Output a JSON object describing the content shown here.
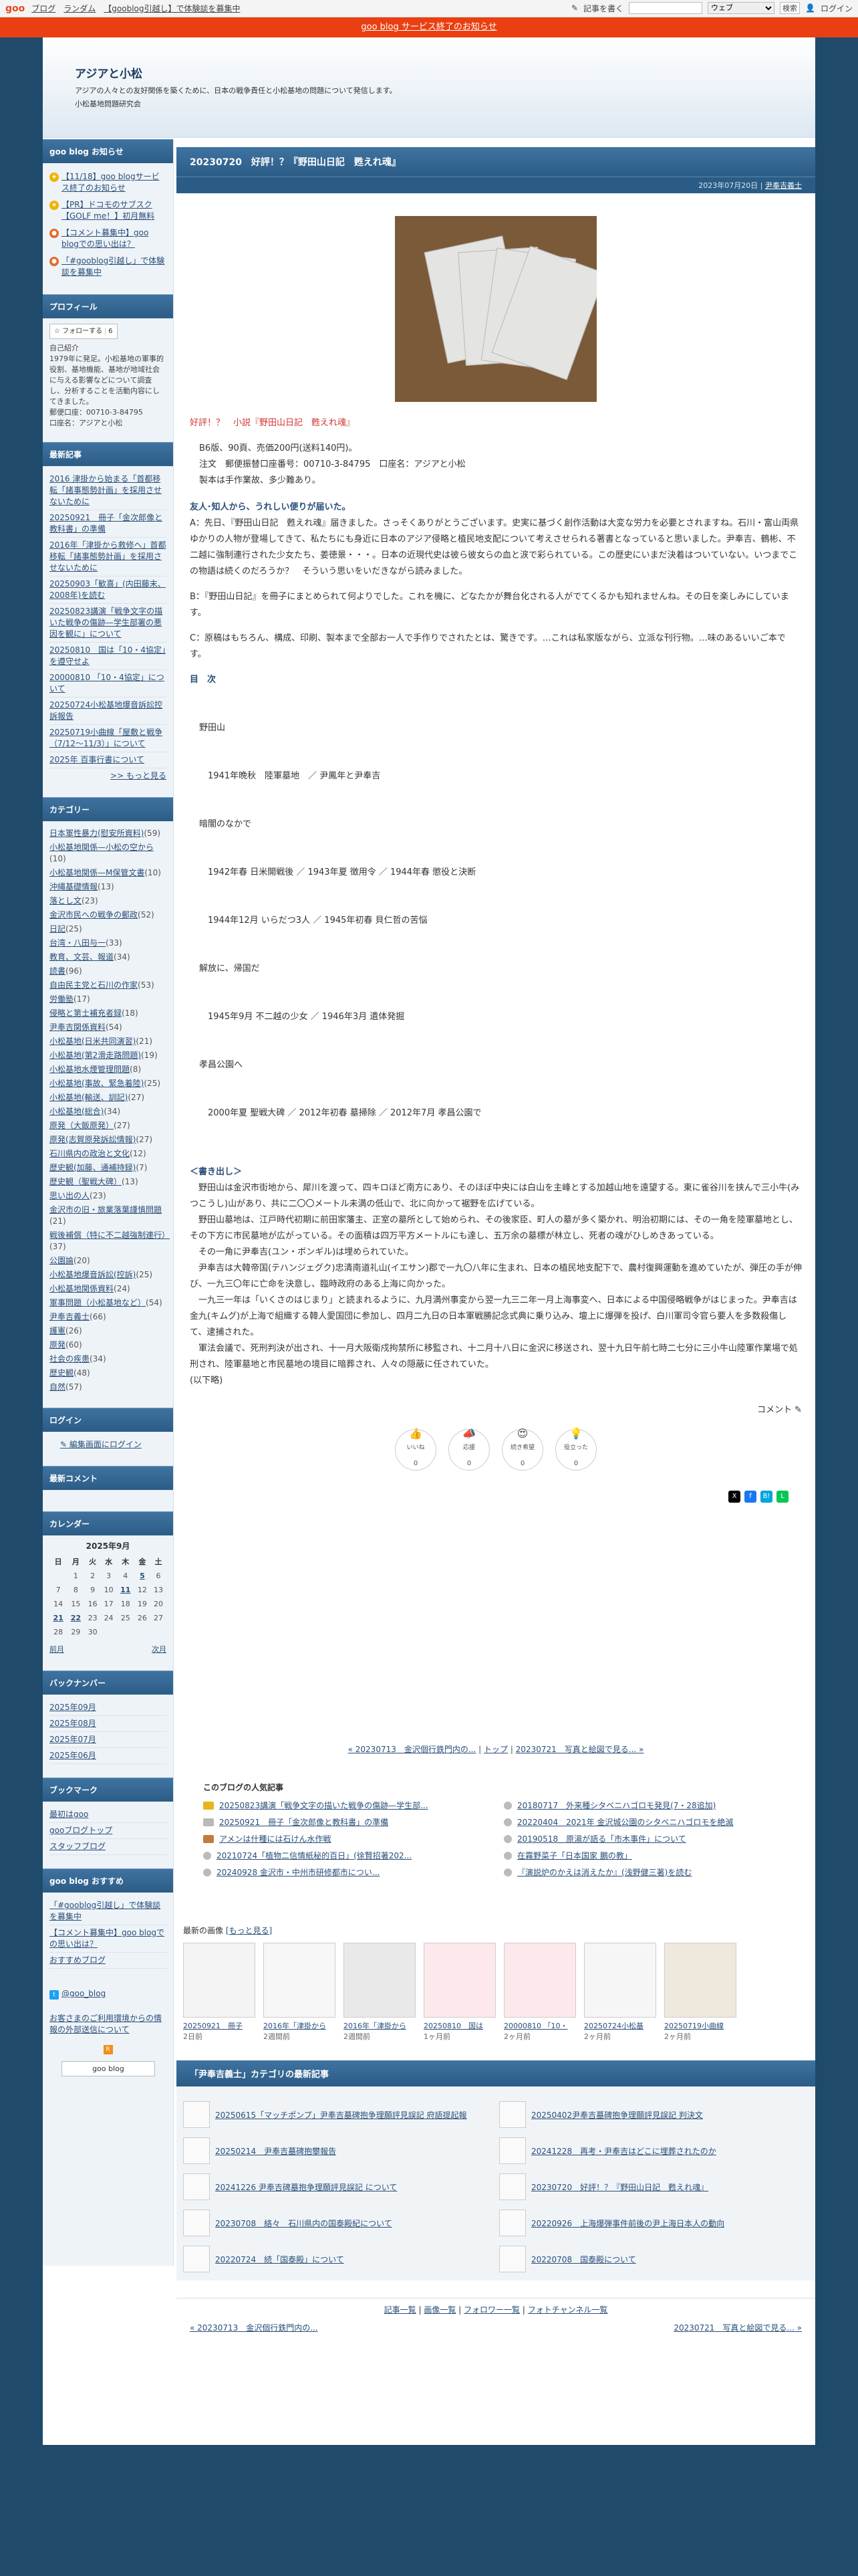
{
  "topbar": {
    "logo": "goo",
    "links": [
      "ブログ",
      "ランダム",
      "【gooblog引越し】で体験談を募集中"
    ],
    "post": "記事を書く",
    "login": "ログイン",
    "search_scope": "ウェブ",
    "search_button": "検索"
  },
  "notice": "goo blog サービス終了のお知らせ",
  "blog": {
    "title": "アジアと小松",
    "description": "アジアの人々との友好関係を築くために、日本の戦争責任と小松基地の問題について発信します。",
    "author": "小松基地問題研究会"
  },
  "sidebar": {
    "news_head": "goo blog お知らせ",
    "news": [
      "【11/18】goo blogサービス終了のお知らせ",
      "【PR】ドコモのサブスク【GOLF me！】初月無料",
      "【コメント募集中】goo blogでの思い出は？",
      "「#gooblog引越し」で体験談を募集中"
    ],
    "profile_head": "プロフィール",
    "follow_label": "フォローする",
    "follow_count": "6",
    "profile_label": "自己紹介",
    "profile_text": "1979年に発足。小松基地の軍事的役割、基地機能、基地が地域社会に与える影響などについて調査し、分析することを活動内容にしてきました。",
    "postal": "郵便口座：00710-3-84795",
    "postal_name": "口座名：アジアと小松",
    "recent_head": "最新記事",
    "recent": [
      "2016 津掛から始まる「首都移転「諸事態勢計画」を採用させないために",
      "20250921　冊子「金次郎像と教科書」の準備",
      "2016年「津掛から救修へ」首都移転「諸事態勢計画」を採用させないために",
      "20250903「歓喜」(内田藤末、2008年)を読む",
      "20250823講演「戦争文字の描いた戦争の傷跡—学生部署の悪因を観に」について",
      "20250810　国は「10・4協定」を遵守せよ",
      "20000810 「10・4協定」について",
      "20250724小松基地爆音訴訟控訴報告",
      "20250719小曲線「屋敷と戦争（7/12〜11/3）」について",
      "2025年 百事行書について"
    ],
    "recent_more": ">> もっと見る",
    "category_head": "カテゴリー",
    "categories": [
      {
        "name": "日本軍性暴力(慰安所資料)",
        "count": "(59)"
      },
      {
        "name": "小松基地関係—小松の空から",
        "count": "(10)"
      },
      {
        "name": "小松基地関係—M保管文書",
        "count": "(10)"
      },
      {
        "name": "沖縄基礎情報",
        "count": "(13)"
      },
      {
        "name": "落とし文",
        "count": "(23)"
      },
      {
        "name": "金沢市民への戦争の郵政",
        "count": "(52)"
      },
      {
        "name": "日記",
        "count": "(25)"
      },
      {
        "name": "台湾・八田与一",
        "count": "(33)"
      },
      {
        "name": "教育、文芸、報道",
        "count": "(34)"
      },
      {
        "name": "読書",
        "count": "(96)"
      },
      {
        "name": "自由民主党と石川の作家",
        "count": "(53)"
      },
      {
        "name": "労働塾",
        "count": "(17)"
      },
      {
        "name": "侵略と第士補充者録",
        "count": "(18)"
      },
      {
        "name": "尹奉吉関係資料",
        "count": "(54)"
      },
      {
        "name": "小松基地(日米共同演習)",
        "count": "(21)"
      },
      {
        "name": "小松基地(第2滑走路問題)",
        "count": "(19)"
      },
      {
        "name": "小松基地水煙管理問題",
        "count": "(8)"
      },
      {
        "name": "小松基地(事故、緊急着陸)",
        "count": "(25)"
      },
      {
        "name": "小松基地(輸送、訓記)",
        "count": "(27)"
      },
      {
        "name": "小松基地(総合)",
        "count": "(34)"
      },
      {
        "name": "原発（大飯原発）",
        "count": "(27)"
      },
      {
        "name": "原発(志賀原発訴訟情報)",
        "count": "(27)"
      },
      {
        "name": "石川県内の政治と文化",
        "count": "(12)"
      },
      {
        "name": "歴史観(加藤、通補持録)",
        "count": "(7)"
      },
      {
        "name": "歴史観（聖戦大碑）",
        "count": "(13)"
      },
      {
        "name": "思い出の人",
        "count": "(23)"
      },
      {
        "name": "金沢市の旧・旅業落葉謹慎問題",
        "count": "(21)"
      },
      {
        "name": "戦後補償（特に不二越強制連行）",
        "count": "(37)"
      },
      {
        "name": "公園論",
        "count": "(20)"
      },
      {
        "name": "小松基地爆音訴訟(控訴)",
        "count": "(25)"
      },
      {
        "name": "小松基地関係資料",
        "count": "(24)"
      },
      {
        "name": "軍事問題（小松基地など）",
        "count": "(54)"
      },
      {
        "name": "尹奉吉義士",
        "count": "(66)"
      },
      {
        "name": "護憲",
        "count": "(26)"
      },
      {
        "name": "原発",
        "count": "(60)"
      },
      {
        "name": "社会の疾患",
        "count": "(34)"
      },
      {
        "name": "歴史観",
        "count": "(48)"
      },
      {
        "name": "自然",
        "count": "(57)"
      }
    ],
    "login_head": "ログイン",
    "login_link": "編集画面にログイン",
    "comments_head": "最新コメント",
    "calendar_head": "カレンダー",
    "calendar_title": "2025年9月",
    "weekdays": [
      "日",
      "月",
      "火",
      "水",
      "木",
      "金",
      "土"
    ],
    "calendar_rows": [
      [
        "",
        "1",
        "2",
        "3",
        "4",
        "5",
        "6"
      ],
      [
        "7",
        "8",
        "9",
        "10",
        "11",
        "12",
        "13"
      ],
      [
        "14",
        "15",
        "16",
        "17",
        "18",
        "19",
        "20"
      ],
      [
        "21",
        "22",
        "23",
        "24",
        "25",
        "26",
        "27"
      ],
      [
        "28",
        "29",
        "30",
        "",
        "",
        "",
        ""
      ]
    ],
    "cal_prev": "前月",
    "cal_next": "次月",
    "backnumber_head": "バックナンバー",
    "backnumbers": [
      "2025年09月",
      "2025年08月",
      "2025年07月",
      "2025年06月"
    ],
    "bookmark_head": "ブックマーク",
    "bookmarks": [
      "最初はgoo",
      "gooブログトップ",
      "スタッフブログ"
    ],
    "recommend_head": "goo blog おすすめ",
    "recommend": [
      "「#gooblog引越し」で体験談を募集中",
      "【コメント募集中】goo blogでの思い出は？",
      "おすすめブログ"
    ],
    "twitter": "@goo_blog",
    "report": "お客さまのご利用環境からの情報の外部送信について",
    "goo_badge": "goo blog"
  },
  "entry": {
    "title": "20230720　好評！？『野田山日記　甦えれ魂』",
    "date": "2023年07月20日",
    "category": "尹奉吉義士",
    "heading": "好評！？　小説『野田山日記　甦えれ魂』",
    "p1": [
      "B6版、90頁、売価200円(送料140円)。",
      "注文　郵便振替口座番号：00710-3-84795　口座名：アジアと小松",
      "製本は手作業故、多少難あり。"
    ],
    "h2": "友人･知人から、うれしい便りが届いた。",
    "p2": "A：先日、『野田山日記　甦えれ魂』届きました。さっそくありがとうございます。史実に基づく創作活動は大変な労力を必要とされますね。石川・富山両県ゆかりの人物が登場してきて、私たちにも身近に日本のアジア侵略と植民地支配について考えさせられる著書となっていると思いました。尹奉吉、鶴彬、不二越に強制連行された少女たち、姜徳景・・・。日本の近現代史は彼ら彼女らの血と涙で彩られている。この歴史にいまだ決着はついていない。いつまでこの物語は続くのだろうか？　そういう思いをいだきながら読みました。",
    "p3": "B：『野田山日記』を冊子にまとめられて何よりでした。これを機に、どなたかが舞台化される人がでてくるかも知れませんね。その日を楽しみにしています。",
    "p4": "C：原稿はもちろん、構成、印刷、製本まで全部お一人で手作りでされたとは、驚きです。…これは私家版ながら、立派な刊行物。…味のあるいいご本です。",
    "toc_head": "目　次",
    "toc": [
      "野田山",
      "　1941年晩秋　陸軍墓地　／ 尹鳳年と尹奉吉",
      "暗闇のなかで",
      "　1942年春 日米開戦後 ／ 1943年夏 徴用令 ／ 1944年春 懲役と決断",
      "　1944年12月 いらだつ3人 ／ 1945年初春 貝仁哲の苦悩",
      "解放に、帰国だ",
      "　1945年9月 不二越の少女 ／ 1946年3月 遺体発掘",
      "孝昌公園へ",
      "　2000年夏 聖戦大碑 ／ 2012年初春 墓掃除 ／ 2012年7月 孝昌公園で"
    ],
    "kakidashi_head": "＜書き出し＞",
    "kakidashi": "　野田山は金沢市街地から、犀川を渡って、四キロほど南方にあり、そのほぼ中央には白山を主峰とする加越山地を遠望する。東に雀谷川を挟んで三小牛(みつこうし)山があり、共に二〇〇メートル未満の低山で、北に向かって裾野を広げている。\n　野田山墓地は、江戸時代初期に前田家藩主、正室の墓所として始められ、その後家臣、町人の墓が多く築かれ、明治初期には、その一角を陸軍墓地とし、その下方に市民墓地が広がっている。その面積は四万平方メートルにも達し、五万余の墓標が林立し、死者の魂がひしめきあっている。\n　その一角に尹奉吉(ユン・ボンギル)は埋められていた。\n　尹奉吉は大韓帝国(テハンジェグク)忠清南道礼山(イエサン)郡で一九〇八年に生まれ、日本の植民地支配下で、農村復興運動を進めていたが、弾圧の手が伸び、一九三〇年に亡命を決意し、臨時政府のある上海に向かった。\n　一九三一年は「いくさのはじまり」と読まれるように、九月満州事変から翌一九三二年一月上海事変へ、日本による中国侵略戦争がはじまった。尹奉吉は金九(キムグ)が上海で組織する韓人愛国団に参加し、四月二九日の日本軍戦勝記念式典に乗り込み、壇上に爆弾を投げ、白川軍司令官ら要人を多数殺傷して、逮捕された。\n　軍法会議で、死刑判決が出され、十一月大阪衛戍拘禁所に移監され、十二月十八日に金沢に移送され、翌十九日午前七時二七分に三小牛山陸軍作業場で処刑され、陸軍墓地と市民墓地の境目に暗葬され、人々の隠蔽に任されていた。",
    "ellipsis": "(以下略)",
    "comment_label": "コメント",
    "reactions": [
      {
        "label": "いいね",
        "emoji": "👍",
        "count": "0"
      },
      {
        "label": "応援",
        "emoji": "📣",
        "count": "0"
      },
      {
        "label": "続き希望",
        "emoji": "😍",
        "count": "0"
      },
      {
        "label": "役立った",
        "emoji": "💡",
        "count": "0"
      }
    ]
  },
  "pager": {
    "prev": "« 20230713　金沢個行鉄門内の...",
    "top": "トップ",
    "next": "20230721　写真と絵図で見る... »"
  },
  "popular": {
    "head": "このブログの人気記事",
    "items": [
      "20250823講演「戦争文字の描いた戦争の傷跡—学生部...",
      "20180717　外来種シタベニハゴロモ発見(7・28追加)",
      "20250921　冊子「金次郎像と教科書」の準備",
      "20220404　2021年 金沢城公園のシタベニハゴロモを絶滅",
      "アメンは什種には石けん水作戦",
      "20190518　原湯が語る「市木事件」について",
      "20210724「植物二信情紙秘的百日」(徐賢招著202...",
      "在霧野菜子「日本国家 鵬の教」",
      "20240928 金沢市・中州市研修都市につい...",
      "『演説炉のかえは消えたか』(浅野健三著)を読む"
    ]
  },
  "recent_images": {
    "head": "最新の画像",
    "more": "[もっと見る]",
    "items": [
      {
        "title": "20250921　冊子",
        "ago": "2日前"
      },
      {
        "title": "2016年「津掛から",
        "ago": "2週間前"
      },
      {
        "title": "2016年「津掛から",
        "ago": "2週間前"
      },
      {
        "title": "20250810　国は",
        "ago": "1ヶ月前"
      },
      {
        "title": "20000810 「10・",
        "ago": "2ヶ月前"
      },
      {
        "title": "20250724小松基",
        "ago": "2ヶ月前"
      },
      {
        "title": "20250719小曲線",
        "ago": "2ヶ月前"
      }
    ]
  },
  "cat_recent": {
    "head": "「尹奉吉義士」カテゴリの最新記事",
    "items": [
      "20250615「マッチポンプ」尹奉吉墓碑抱争理願評見誤記 府語提起報",
      "20250402尹奉吉墓碑抱争理願評見誤記 判決文",
      "20250214　尹奉吉墓碑抱攀報告",
      "20241228　再考・尹奉吉はどこに埋葬されたのか",
      "20241226 尹奉吉碑墓抱争理願評見誤記 について",
      "20230720　好評！？『野田山日記　甦えれ魂』",
      "20230708　絡々　石川県内の国泰殿紀について",
      "20220926　上海爆弾事件前後の尹上海日本人の動向",
      "20220724　続「国泰殿」について",
      "20220708　国泰殿について"
    ]
  },
  "footer": {
    "links": [
      "記事一覧",
      "画像一覧",
      "フォロワー一覧",
      "フォトチャンネル一覧"
    ],
    "prev": "« 20230713　金沢個行鉄門内の...",
    "next": "20230721　写真と絵図で見る... »"
  }
}
